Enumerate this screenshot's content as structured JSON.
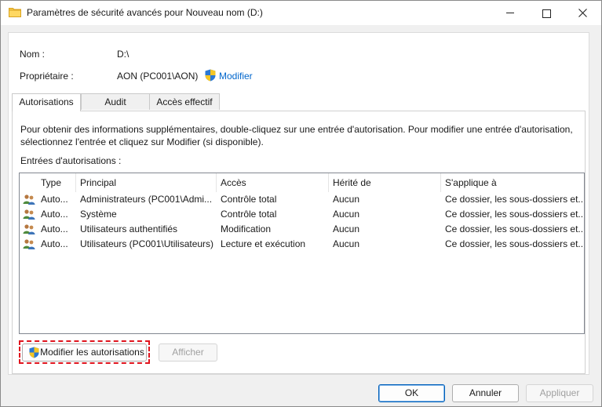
{
  "window": {
    "title": "Paramètres de sécurité avancés pour Nouveau nom (D:)",
    "folder_icon": "folder-icon",
    "controls": {
      "minimize": "minimize-icon",
      "maximize": "maximize-icon",
      "close": "close-icon"
    }
  },
  "info": {
    "name_label": "Nom :",
    "name_value": "D:\\",
    "owner_label": "Propriétaire :",
    "owner_value": "AON (PC001\\AON)",
    "owner_action": "Modifier"
  },
  "tabs": [
    {
      "label": "Autorisations",
      "active": true
    },
    {
      "label": "Audit",
      "active": false
    },
    {
      "label": "Accès effectif",
      "active": false
    }
  ],
  "description": "Pour obtenir des informations supplémentaires, double-cliquez sur une entrée d'autorisation. Pour modifier une entrée d'autorisation, sélectionnez l'entrée et cliquez sur Modifier (si disponible).",
  "entries_label": "Entrées d'autorisations :",
  "table": {
    "columns": [
      "Type",
      "Principal",
      "Accès",
      "Hérité de",
      "S'applique à"
    ],
    "rows": [
      {
        "type": "Auto...",
        "principal": "Administrateurs (PC001\\Admi...",
        "access": "Contrôle total",
        "inherited": "Aucun",
        "applies": "Ce dossier, les sous-dossiers et..."
      },
      {
        "type": "Auto...",
        "principal": "Système",
        "access": "Contrôle total",
        "inherited": "Aucun",
        "applies": "Ce dossier, les sous-dossiers et..."
      },
      {
        "type": "Auto...",
        "principal": "Utilisateurs authentifiés",
        "access": "Modification",
        "inherited": "Aucun",
        "applies": "Ce dossier, les sous-dossiers et..."
      },
      {
        "type": "Auto...",
        "principal": "Utilisateurs (PC001\\Utilisateurs)",
        "access": "Lecture et exécution",
        "inherited": "Aucun",
        "applies": "Ce dossier, les sous-dossiers et..."
      }
    ]
  },
  "actions": {
    "edit_permissions": "Modifier les autorisations",
    "view": "Afficher"
  },
  "footer": {
    "ok": "OK",
    "cancel": "Annuler",
    "apply": "Appliquer"
  },
  "colors": {
    "highlight_border": "#e0141e",
    "link": "#0066cc",
    "default_button": "#005fb8"
  }
}
